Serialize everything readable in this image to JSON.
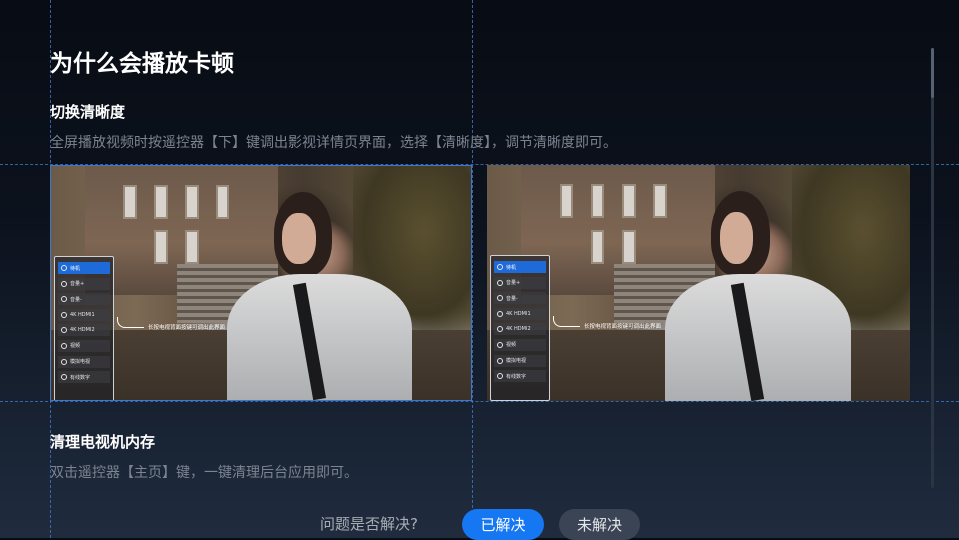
{
  "page": {
    "title": "为什么会播放卡顿"
  },
  "sections": [
    {
      "title": "切换清晰度",
      "desc": "全屏播放视频时按遥控器【下】键调出影视详情页界面，选择【清晰度】，调节清晰度即可。"
    },
    {
      "title": "清理电视机内存",
      "desc": "双击遥控器【主页】键，一键清理后台应用即可。"
    }
  ],
  "screenshots": [
    {
      "menu_items": [
        "待机",
        "音量+",
        "音量-",
        "4K HDMI1",
        "4K HDMI2",
        "视频",
        "模拟电视",
        "有线数字"
      ],
      "callout": "长按电视背面按键可调出此界面"
    },
    {
      "menu_items": [
        "待机",
        "音量+",
        "音量-",
        "4K HDMI1",
        "4K HDMI2",
        "视频",
        "模拟电视",
        "有线数字"
      ],
      "callout": "长按电视背面按键可调出此界面"
    }
  ],
  "feedback": {
    "question": "问题是否解决?",
    "resolved_label": "已解决",
    "unresolved_label": "未解决"
  },
  "colors": {
    "accent": "#1677f2",
    "guide": "#3f78c9",
    "secondary_button": "#3a4454"
  }
}
